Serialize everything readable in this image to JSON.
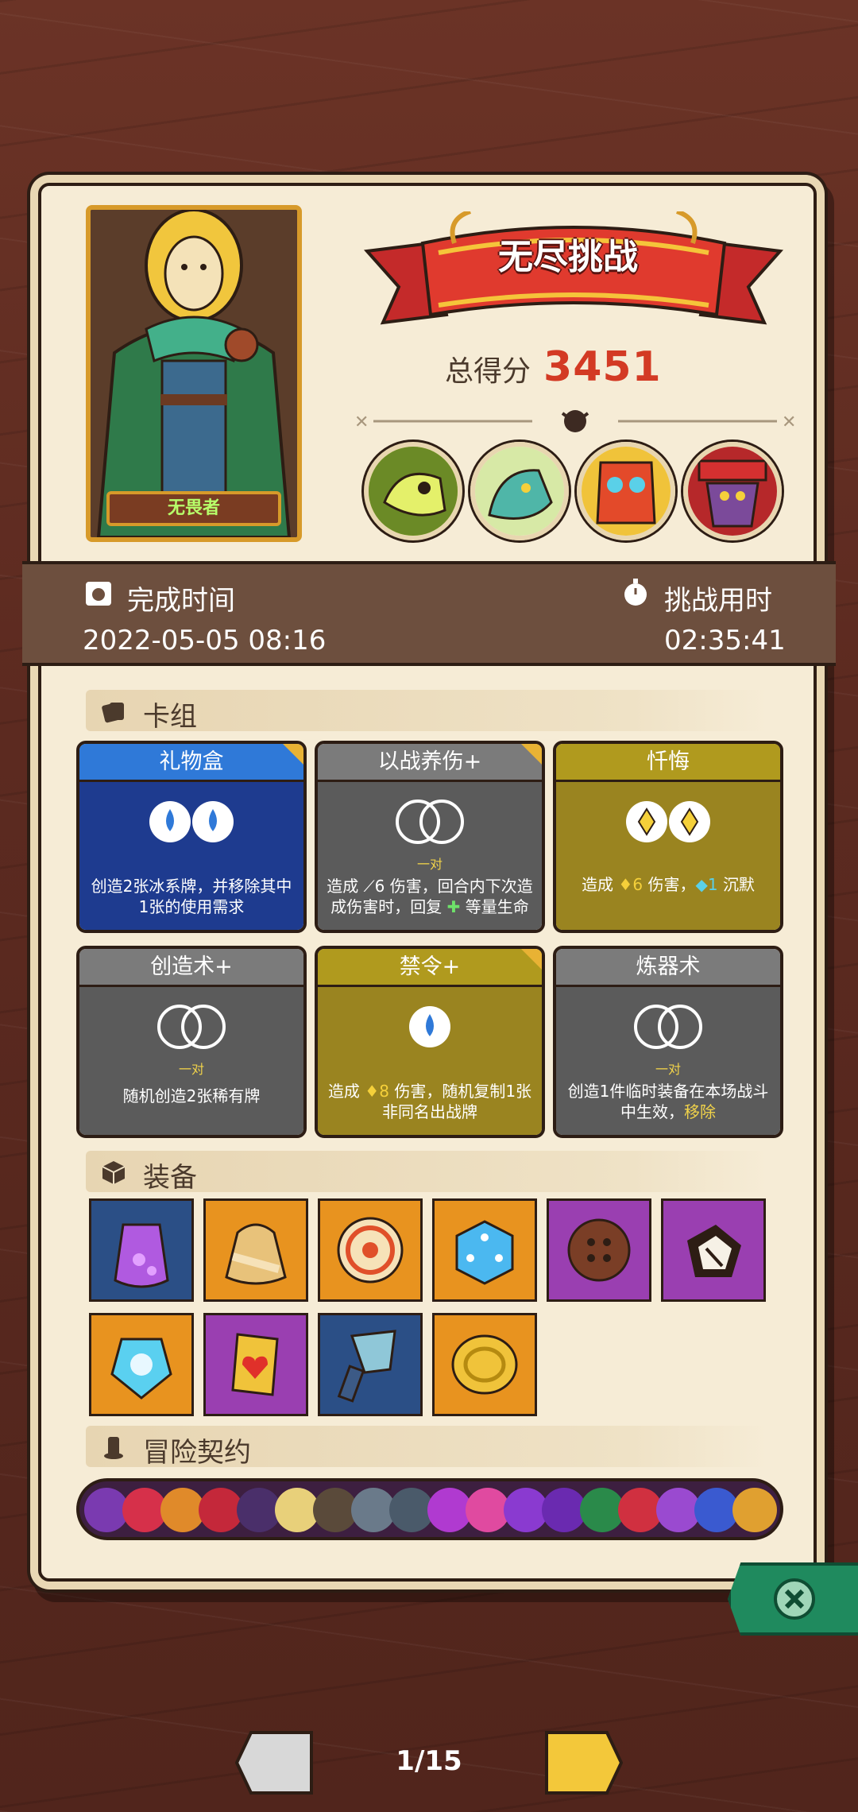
{
  "hero": {
    "name": "无畏者"
  },
  "header": {
    "title": "无尽挑战",
    "score_label": "总得分",
    "score_value": "3451"
  },
  "bosses": [
    {
      "icon": "dino-skull-boss-icon"
    },
    {
      "icon": "dragon-boss-icon"
    },
    {
      "icon": "tribal-mask-boss-icon"
    },
    {
      "icon": "red-hat-boss-icon"
    }
  ],
  "completion": {
    "time_label": "完成时间",
    "time_value": "2022-05-05 08:16",
    "duration_label": "挑战用时",
    "duration_value": "02:35:41"
  },
  "deck": {
    "title": "卡组",
    "cards": [
      {
        "name": "礼物盒",
        "color": "blue",
        "pair": "",
        "desc": "创造2张冰系牌，并移除其中1张的使用需求"
      },
      {
        "name": "以战养伤+",
        "color": "gray",
        "pair": "一对",
        "desc_a": "造成",
        "desc_b": "6 伤害，回合内下次造成伤害时，回复",
        "desc_c": "等量生命"
      },
      {
        "name": "忏悔",
        "color": "gold",
        "pair": "",
        "desc_a": "造成",
        "desc_b": "6",
        "desc_c": "伤害，",
        "desc_d": "1",
        "desc_e": "沉默"
      },
      {
        "name": "创造术+",
        "color": "gray",
        "pair": "一对",
        "desc": "随机创造2张稀有牌"
      },
      {
        "name": "禁令+",
        "color": "gold",
        "pair": "",
        "desc_a": "造成",
        "desc_b": "8",
        "desc_c": "伤害，随机复制1张非同名出战牌"
      },
      {
        "name": "炼器术",
        "color": "gray",
        "pair": "一对",
        "desc_a": "创造1件临时装备在本场战斗中生效，",
        "desc_b": "移除"
      }
    ]
  },
  "equipment": {
    "title": "装备",
    "items": [
      {
        "icon": "purple-potion-jug-icon",
        "bg": "navy"
      },
      {
        "icon": "coin-sack-icon",
        "bg": "orange"
      },
      {
        "icon": "round-shield-icon",
        "bg": "orange"
      },
      {
        "icon": "blue-dice-icon",
        "bg": "orange"
      },
      {
        "icon": "wooden-button-icon",
        "bg": "purple"
      },
      {
        "icon": "cracked-dice-icon",
        "bg": "purple"
      },
      {
        "icon": "ice-crest-icon",
        "bg": "orange"
      },
      {
        "icon": "heart-shield-icon",
        "bg": "purple"
      },
      {
        "icon": "cleaver-icon",
        "bg": "navy"
      },
      {
        "icon": "gold-coin-icon",
        "bg": "orange"
      }
    ]
  },
  "contracts": {
    "title": "冒险契约"
  },
  "pagination": {
    "current": "1/15"
  },
  "colors": {
    "paper": "#f6ecd6",
    "score": "#d33a24",
    "close": "#1f8a5e"
  }
}
